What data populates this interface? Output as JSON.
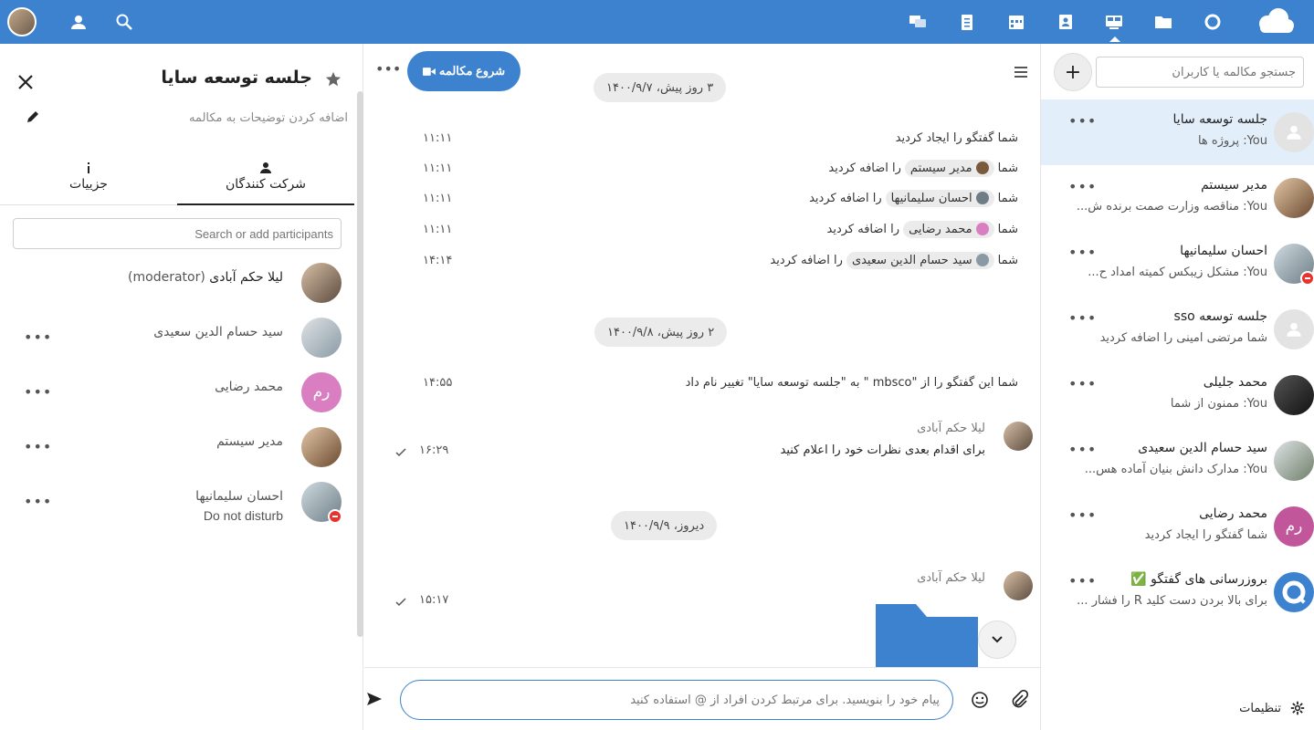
{
  "colors": {
    "brand": "#3d82cf",
    "selected_row": "#e3eefb",
    "dnd": "#e9322d"
  },
  "topbar": {
    "left_icons": [
      "user-avatar",
      "contacts-icon",
      "search-icon"
    ],
    "app_icons": [
      "talk-icon",
      "tasks-icon",
      "calendar-icon",
      "contacts-app-icon",
      "spreed-icon",
      "files-icon",
      "circles-icon",
      "cloud-logo"
    ]
  },
  "details": {
    "title": "جلسه توسعه سایا",
    "description_placeholder": "اضافه کردن توضیحات به مکالمه",
    "tabs": [
      {
        "label": "شرکت کنندگان",
        "active": true
      },
      {
        "label": "جزییات",
        "active": false
      }
    ],
    "search_placeholder": "Search or add participants",
    "participants": [
      {
        "name": "لیلا حکم آبادی",
        "suffix": "(moderator)",
        "sub": ""
      },
      {
        "name": "سید حسام الدین سعیدی",
        "sub": ""
      },
      {
        "name": "محمد رضایی",
        "initials": "رم",
        "sub": ""
      },
      {
        "name": "مدیر سیستم",
        "sub": ""
      },
      {
        "name": "احسان سلیمانیها",
        "sub": "Do not disturb"
      }
    ]
  },
  "chat": {
    "start_call_label": "شروع مکالمه",
    "dates": [
      "۳ روز پیش، ۱۴۰۰/۹/۷",
      "۲ روز پیش، ۱۴۰۰/۹/۸",
      "دیروز، ۱۴۰۰/۹/۹"
    ],
    "system": [
      {
        "text": "شما گفتگو را ایجاد کردید",
        "time": "۱۱:۱۱"
      },
      {
        "prefix": "شما",
        "mention": "مدیر سیستم",
        "suffix": "را اضافه کردید",
        "time": "۱۱:۱۱"
      },
      {
        "prefix": "شما",
        "mention": "احسان سلیمانیها",
        "suffix": "را اضافه کردید",
        "time": "۱۱:۱۱"
      },
      {
        "prefix": "شما",
        "mention": "محمد رضایی",
        "suffix": "را اضافه کردید",
        "time": "۱۱:۱۱"
      },
      {
        "prefix": "شما",
        "mention": "سید حسام الدین سعیدی",
        "suffix": "را اضافه کردید",
        "time": "۱۴:۱۴"
      },
      {
        "text": "شما این گفتگو را از \"mbsco \" به \"جلسه توسعه سایا\" تغییر نام داد",
        "time": "۱۴:۵۵"
      }
    ],
    "messages": [
      {
        "author": "لیلا حکم آبادی",
        "text": "برای اقدام بعدی نظرات خود را اعلام کنید",
        "time": "۱۶:۲۹"
      },
      {
        "author": "لیلا حکم آبادی",
        "text": "",
        "time": "۱۵:۱۷"
      }
    ],
    "input_placeholder": "پیام خود را بنویسید. برای مرتبط کردن افراد از @ استفاده کنید"
  },
  "sidebar": {
    "search_placeholder": "جستجو مکالمه یا کاربران",
    "conversations": [
      {
        "name": "جلسه توسعه سایا",
        "last": "You: پروژه ها",
        "selected": true
      },
      {
        "name": "مدیر سیستم",
        "last": "You: مناقصه وزارت صمت برنده ش..."
      },
      {
        "name": "احسان سلیمانیها",
        "last": "You: مشکل زیبکس کمیته امداد ح..."
      },
      {
        "name": "جلسه توسعه sso",
        "last": "شما مرتضی امینی را اضافه کردید"
      },
      {
        "name": "محمد جلیلی",
        "last": "You: ممنون از شما"
      },
      {
        "name": "سید حسام الدین سعیدی",
        "last": "You: مدارک دانش بنیان آماده هس..."
      },
      {
        "name": "محمد رضایی",
        "initials": "رم",
        "last": "شما گفتگو را ایجاد کردید"
      },
      {
        "name": "بروزرسانی های گفتگو ✅",
        "last": "برای بالا بردن دست کلید R را فشار ..."
      }
    ],
    "settings_label": "تنظیمات"
  }
}
